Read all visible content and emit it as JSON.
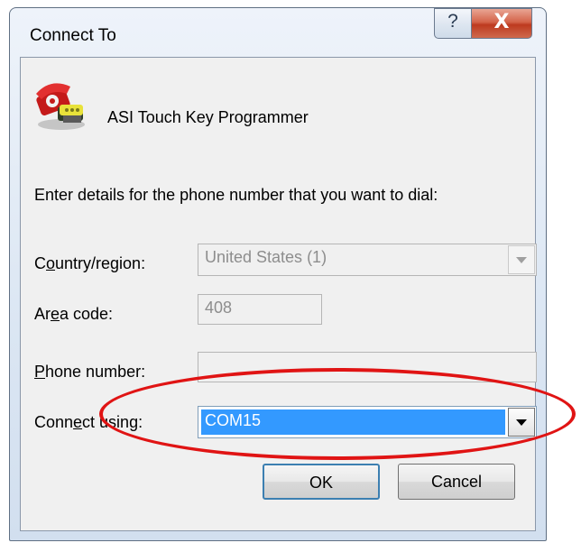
{
  "window": {
    "title": "Connect To",
    "help_glyph": "?",
    "close_glyph": "X"
  },
  "connection": {
    "name": "ASI Touch Key Programmer",
    "icon": "phone-connection-icon"
  },
  "prompt": "Enter details for the phone number that you want to dial:",
  "form": {
    "country_label_pre": "C",
    "country_label_u": "o",
    "country_label_post": "untry/region:",
    "country_value": "United States (1)",
    "area_label_pre": "Ar",
    "area_label_u": "e",
    "area_label_post": "a code:",
    "area_value": "408",
    "phone_label_pre": "",
    "phone_label_u": "P",
    "phone_label_post": "hone number:",
    "phone_value": "",
    "connect_label_pre": "Conn",
    "connect_label_u": "e",
    "connect_label_post": "ct using:",
    "connect_value": "COM15"
  },
  "buttons": {
    "ok": "OK",
    "cancel": "Cancel"
  },
  "colors": {
    "selection": "#3399ff",
    "annotation": "#e01414"
  }
}
